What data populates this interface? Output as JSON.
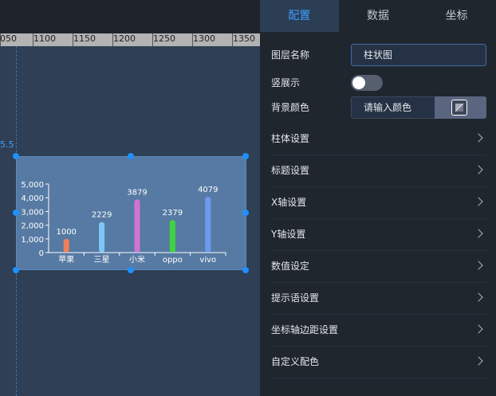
{
  "ruler": {
    "labels": [
      "050",
      "1100",
      "1150",
      "1200",
      "1250",
      "1300",
      "1350"
    ]
  },
  "guide": {
    "value": "5.5"
  },
  "chart_data": {
    "type": "bar",
    "categories": [
      "苹果",
      "三星",
      "小米",
      "oppo",
      "vivo"
    ],
    "values": [
      1000,
      2229,
      3879,
      2379,
      4079
    ],
    "colors": [
      "#f0805a",
      "#7ec8f5",
      "#d473d4",
      "#3fd43f",
      "#6b9cf0"
    ],
    "ylim": [
      0,
      5000
    ],
    "yticks": [
      "5,000",
      "4,000",
      "3,000",
      "2,000",
      "1,000",
      "0"
    ],
    "title": "",
    "xlabel": "",
    "ylabel": ""
  },
  "tabs": [
    {
      "label": "配置",
      "active": true
    },
    {
      "label": "数据",
      "active": false
    },
    {
      "label": "坐标",
      "active": false
    }
  ],
  "config": {
    "layer_name_label": "图层名称",
    "layer_name_value": "柱状图",
    "vertical_label": "竖展示",
    "vertical_on": false,
    "bg_color_label": "背景颜色",
    "bg_color_placeholder": "请输入颜色"
  },
  "sections": [
    {
      "label": "柱体设置"
    },
    {
      "label": "标题设置"
    },
    {
      "label": "X轴设置"
    },
    {
      "label": "Y轴设置"
    },
    {
      "label": "数值设定"
    },
    {
      "label": "提示语设置"
    },
    {
      "label": "坐标轴边距设置"
    },
    {
      "label": "自定义配色"
    }
  ],
  "colors": {
    "accent": "#409eff",
    "panel_bg": "#20262e",
    "canvas_bg": "#2f3f55",
    "widget_bg": "#567aa3"
  }
}
